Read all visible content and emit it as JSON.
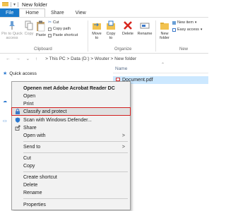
{
  "window": {
    "title": "New folder"
  },
  "tabs": [
    {
      "label": "File"
    },
    {
      "label": "Home"
    },
    {
      "label": "Share"
    },
    {
      "label": "View"
    }
  ],
  "ribbon": {
    "pin_quick_access": "Pin to Quick access",
    "copy": "Copy",
    "paste": "Paste",
    "cut": "Cut",
    "copy_path": "Copy path",
    "paste_shortcut": "Paste shortcut",
    "clipboard_group": "Clipboard",
    "move_to": "Move to",
    "copy_to": "Copy to",
    "delete": "Delete",
    "rename": "Rename",
    "organize_group": "Organize",
    "new_folder": "New folder",
    "new_item": "New item",
    "easy_access": "Easy access",
    "new_group": "New"
  },
  "address": {
    "nav": "← → ⌄ ↑",
    "path": "> This PC > Data (D:) > Wouter > New folder"
  },
  "content": {
    "column_name": "Name",
    "file_name": "Document.pdf"
  },
  "navpane": {
    "quick_access": "Quick access"
  },
  "menu": {
    "items": [
      {
        "label": "Openen met Adobe Acrobat Reader DC"
      },
      {
        "label": "Open"
      },
      {
        "label": "Print"
      },
      {
        "label": "Classify and protect"
      },
      {
        "label": "Scan with Windows Defender..."
      },
      {
        "label": "Share"
      },
      {
        "label": "Open with"
      },
      {
        "label": "Send to"
      },
      {
        "label": "Cut"
      },
      {
        "label": "Copy"
      },
      {
        "label": "Create shortcut"
      },
      {
        "label": "Delete"
      },
      {
        "label": "Rename"
      },
      {
        "label": "Properties"
      }
    ]
  },
  "colors": {
    "accent": "#1979ca",
    "highlight_border": "#d21f1f",
    "selection": "#cce8ff"
  }
}
